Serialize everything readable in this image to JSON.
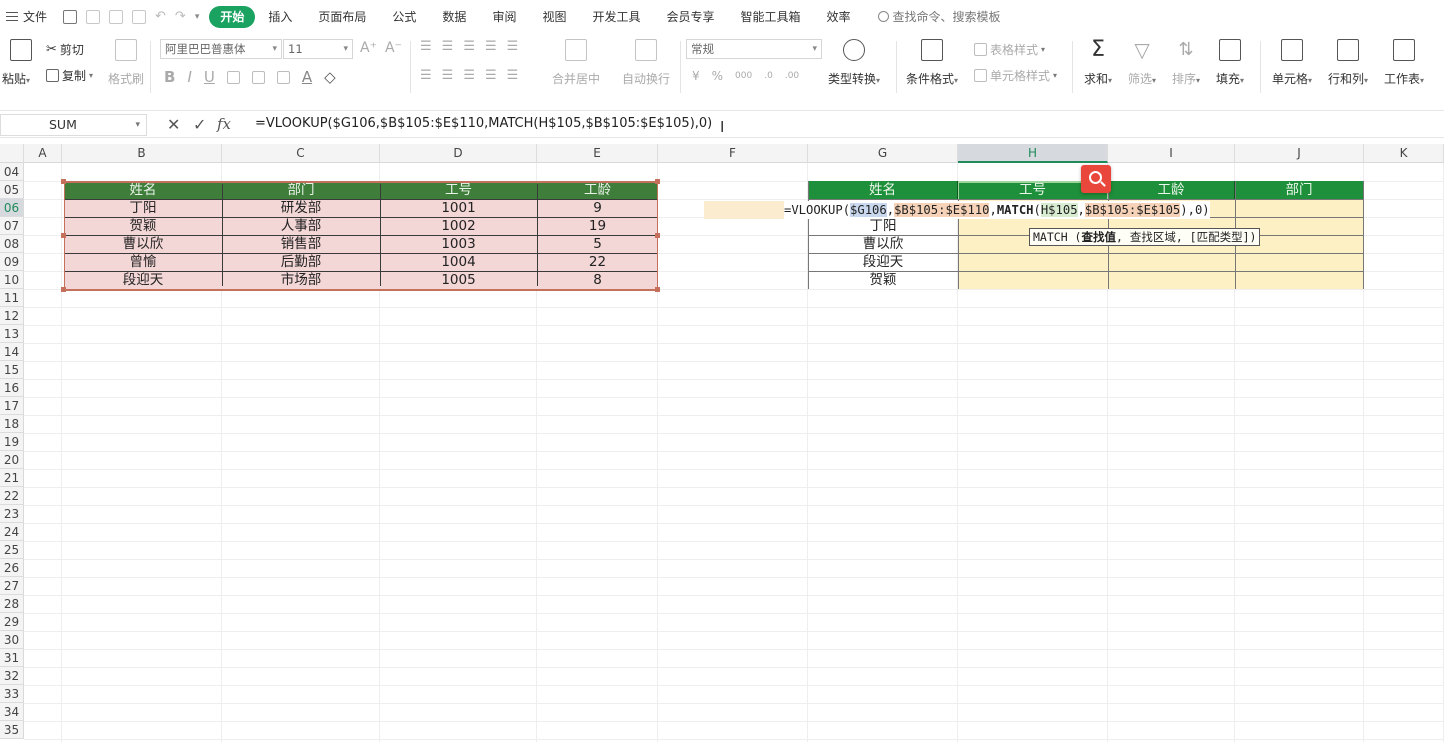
{
  "menu": {
    "file_label": "文件",
    "tabs": [
      "开始",
      "插入",
      "页面布局",
      "公式",
      "数据",
      "审阅",
      "视图",
      "开发工具",
      "会员专享",
      "智能工具箱",
      "效率"
    ],
    "active_tab": "开始",
    "search_placeholder": "查找命令、搜索模板"
  },
  "ribbon": {
    "paste": "粘贴",
    "cut": "剪切",
    "copy": "复制",
    "format_painter": "格式刷",
    "font_name": "阿里巴巴普惠体",
    "font_size": "11",
    "merge_center": "合并居中",
    "wrap_text": "自动换行",
    "number_format": "常规",
    "type_convert": "类型转换",
    "conditional_format": "条件格式",
    "table_style": "表格样式",
    "cell_style": "单元格样式",
    "sum": "求和",
    "filter": "筛选",
    "sort": "排序",
    "fill": "填充",
    "cell": "单元格",
    "row_col": "行和列",
    "worksheet": "工作表"
  },
  "formula_bar": {
    "name_box": "SUM",
    "fx": "fx",
    "formula": "=VLOOKUP($G106,$B$105:$E$110,MATCH(H$105,$B$105:$E$105),0)"
  },
  "columns": [
    "A",
    "B",
    "C",
    "D",
    "E",
    "F",
    "G",
    "H",
    "I",
    "J",
    "K"
  ],
  "selected_column": "H",
  "rows": [
    "04",
    "05",
    "06",
    "07",
    "08",
    "09",
    "10",
    "11",
    "12",
    "13",
    "14",
    "15",
    "16",
    "17",
    "18",
    "19",
    "20",
    "21",
    "22",
    "23",
    "24",
    "25",
    "26",
    "27",
    "28",
    "29",
    "30",
    "31",
    "32",
    "33",
    "34",
    "35"
  ],
  "selected_row": "06",
  "left_table": {
    "headers": [
      "姓名",
      "部门",
      "工号",
      "工龄"
    ],
    "rows": [
      [
        "丁阳",
        "研发部",
        "1001",
        "9"
      ],
      [
        "贺颖",
        "人事部",
        "1002",
        "19"
      ],
      [
        "曹以欣",
        "销售部",
        "1003",
        "5"
      ],
      [
        "曾愉",
        "后勤部",
        "1004",
        "22"
      ],
      [
        "段迎天",
        "市场部",
        "1005",
        "8"
      ]
    ]
  },
  "right_table": {
    "headers": [
      "姓名",
      "工号",
      "工龄",
      "部门"
    ],
    "names": [
      "丁阳",
      "曹以欣",
      "段迎天",
      "贺颖"
    ]
  },
  "in_cell_formula": {
    "p1": "=VLOOKUP(",
    "p2": "$G106",
    "p3": ",",
    "p4": "$B$105:$E$110",
    "p5": ",",
    "p6": "MATCH",
    "p7": "(",
    "p8": "H$105",
    "p9": ",",
    "p10": "$B$105:$E$105",
    "p11": "),0)"
  },
  "tooltip": {
    "fn": "MATCH",
    "open": " (",
    "arg1": "查找值",
    "rest": ", 查找区域, [匹配类型])"
  },
  "colors": {
    "accent": "#1aa261",
    "left_header": "#3f7e3a",
    "right_header": "#1e8f3a",
    "pink_fill": "#f3d6d6",
    "yellow_fill": "#fdf0c4"
  }
}
